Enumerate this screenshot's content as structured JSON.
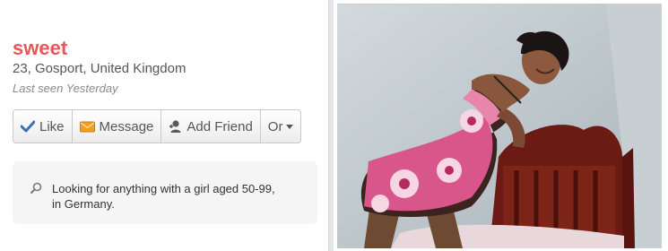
{
  "profile": {
    "username": "sweet",
    "location": "23, Gosport, United Kingdom",
    "last_seen": "Last seen Yesterday"
  },
  "actions": {
    "like_label": "Like",
    "message_label": "Message",
    "add_friend_label": "Add Friend",
    "more_label": "Or"
  },
  "about": {
    "looking_for": "Looking for anything with a girl aged 50-99, in Germany."
  },
  "colors": {
    "username": "#e75757",
    "like_icon": "#3b6fb6",
    "message_icon": "#f0a01e"
  },
  "icons": {
    "like": "checkmark-icon",
    "message": "envelope-icon",
    "add_friend": "person-plus-icon",
    "more": "caret-down-icon",
    "search": "magnifier-icon"
  }
}
